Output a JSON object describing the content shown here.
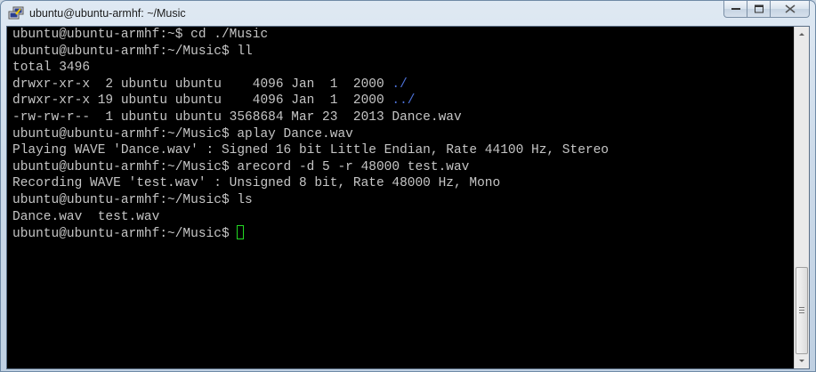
{
  "window": {
    "title": "ubuntu@ubuntu-armhf: ~/Music",
    "icon": "putty-icon",
    "controls": [
      "minimize",
      "maximize",
      "close"
    ]
  },
  "terminal": {
    "lines": [
      "ubuntu@ubuntu-armhf:~$ cd ./Music",
      "ubuntu@ubuntu-armhf:~/Music$ ll",
      "total 3496",
      "drwxr-xr-x  2 ubuntu ubuntu    4096 Jan  1  2000 ",
      "./",
      "drwxr-xr-x 19 ubuntu ubuntu    4096 Jan  1  2000 ",
      "../",
      "-rw-rw-r--  1 ubuntu ubuntu 3568684 Mar 23  2013 Dance.wav",
      "ubuntu@ubuntu-armhf:~/Music$ aplay Dance.wav",
      "Playing WAVE 'Dance.wav' : Signed 16 bit Little Endian, Rate 44100 Hz, Stereo",
      "ubuntu@ubuntu-armhf:~/Music$ arecord -d 5 -r 48000 test.wav",
      "Recording WAVE 'test.wav' : Unsigned 8 bit, Rate 48000 Hz, Mono",
      "ubuntu@ubuntu-armhf:~/Music$ ls",
      "Dance.wav  test.wav",
      "ubuntu@ubuntu-armhf:~/Music$ "
    ],
    "colors": {
      "background": "#000000",
      "text": "#c5c5c5",
      "directory": "#4b6fd4",
      "cursor": "#23d923"
    }
  }
}
